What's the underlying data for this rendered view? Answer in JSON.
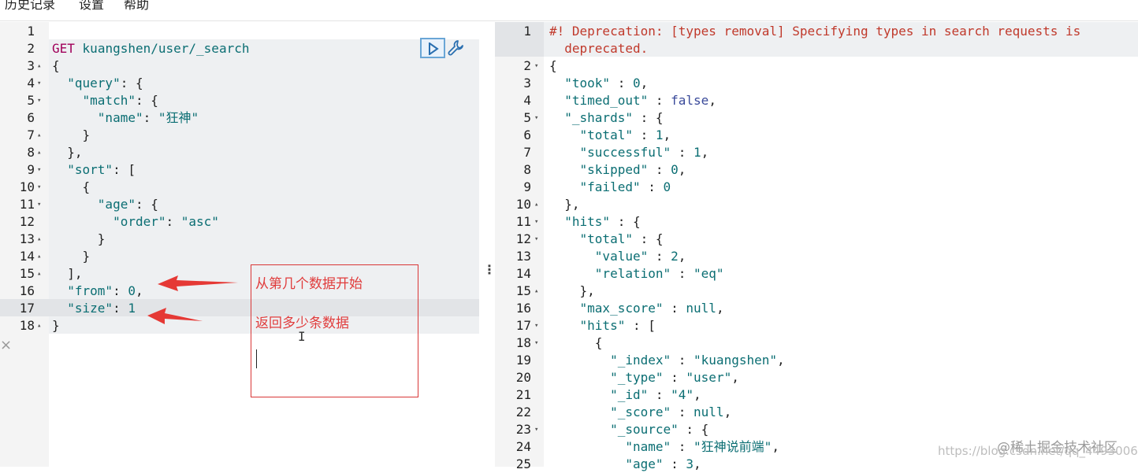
{
  "menu": {
    "history": "历史记录",
    "settings": "设置",
    "help": "帮助"
  },
  "request": {
    "method": "GET",
    "path": "kuangshen/user/_search",
    "lines": [
      {
        "n": "1",
        "t": ""
      },
      {
        "n": "2",
        "t": "GET kuangshen/user/_search"
      },
      {
        "n": "3",
        "t": "{"
      },
      {
        "n": "4",
        "t": "  \"query\": {"
      },
      {
        "n": "5",
        "t": "    \"match\": {"
      },
      {
        "n": "6",
        "t": "      \"name\": \"狂神\""
      },
      {
        "n": "7",
        "t": "    }"
      },
      {
        "n": "8",
        "t": "  },"
      },
      {
        "n": "9",
        "t": "  \"sort\": ["
      },
      {
        "n": "10",
        "t": "    {"
      },
      {
        "n": "11",
        "t": "      \"age\": {"
      },
      {
        "n": "12",
        "t": "        \"order\": \"asc\""
      },
      {
        "n": "13",
        "t": "      }"
      },
      {
        "n": "14",
        "t": "    }"
      },
      {
        "n": "15",
        "t": "  ],"
      },
      {
        "n": "16",
        "t": "  \"from\": 0,"
      },
      {
        "n": "17",
        "t": "  \"size\": 1"
      },
      {
        "n": "18",
        "t": "}"
      }
    ]
  },
  "annotation": {
    "from_note": "从第几个数据开始",
    "size_note": "返回多少条数据"
  },
  "response": {
    "lines": [
      {
        "n": "1",
        "t": "#! Deprecation: [types removal] Specifying types in search requests is"
      },
      {
        "n": "",
        "t": "  deprecated."
      },
      {
        "n": "2",
        "t": "{"
      },
      {
        "n": "3",
        "t": "  \"took\" : 0,"
      },
      {
        "n": "4",
        "t": "  \"timed_out\" : false,"
      },
      {
        "n": "5",
        "t": "  \"_shards\" : {"
      },
      {
        "n": "6",
        "t": "    \"total\" : 1,"
      },
      {
        "n": "7",
        "t": "    \"successful\" : 1,"
      },
      {
        "n": "8",
        "t": "    \"skipped\" : 0,"
      },
      {
        "n": "9",
        "t": "    \"failed\" : 0"
      },
      {
        "n": "10",
        "t": "  },"
      },
      {
        "n": "11",
        "t": "  \"hits\" : {"
      },
      {
        "n": "12",
        "t": "    \"total\" : {"
      },
      {
        "n": "13",
        "t": "      \"value\" : 2,"
      },
      {
        "n": "14",
        "t": "      \"relation\" : \"eq\""
      },
      {
        "n": "15",
        "t": "    },"
      },
      {
        "n": "16",
        "t": "    \"max_score\" : null,"
      },
      {
        "n": "17",
        "t": "    \"hits\" : ["
      },
      {
        "n": "18",
        "t": "      {"
      },
      {
        "n": "19",
        "t": "        \"_index\" : \"kuangshen\","
      },
      {
        "n": "20",
        "t": "        \"_type\" : \"user\","
      },
      {
        "n": "21",
        "t": "        \"_id\" : \"4\","
      },
      {
        "n": "22",
        "t": "        \"_score\" : null,"
      },
      {
        "n": "23",
        "t": "        \"_source\" : {"
      },
      {
        "n": "24",
        "t": "          \"name\" : \"狂神说前端\","
      },
      {
        "n": "25",
        "t": "          \"age\" : 3,"
      }
    ]
  },
  "watermark": {
    "site": "@稀土掘金技术社区",
    "url": "https://blog.csdn.net/qq_44930069"
  },
  "colors": {
    "annotation": "#e03c3c",
    "string": "#0b6e73",
    "warning": "#c0392b"
  }
}
